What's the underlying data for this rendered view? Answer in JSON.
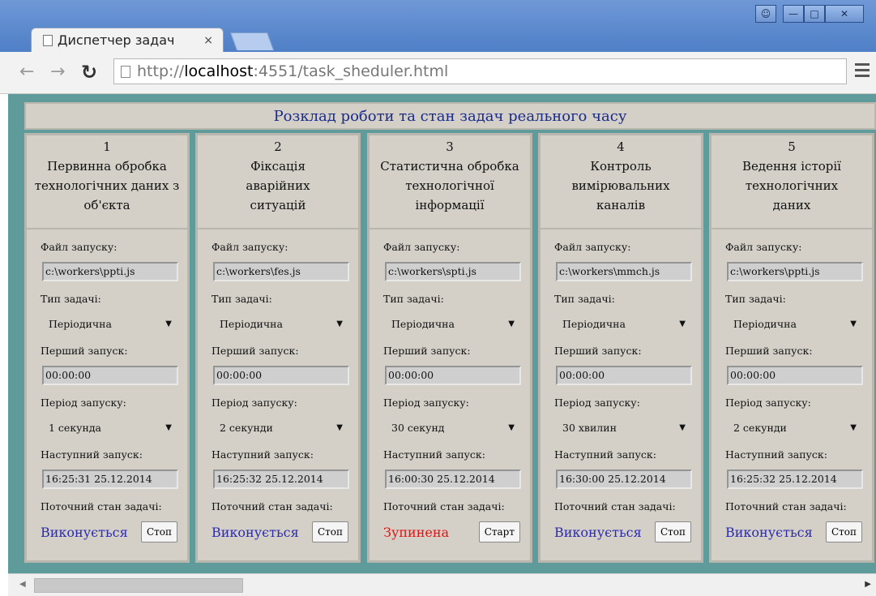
{
  "browser": {
    "tab_title": "Диспетчер задач",
    "tab_close": "×",
    "url_prefix": "http://",
    "url_host": "localhost",
    "url_rest": ":4551/task_sheduler.html"
  },
  "page": {
    "title": "Розклад роботи та стан задач реального часу",
    "labels": {
      "file": "Файл запуску:",
      "type": "Тип задачі:",
      "first": "Перший запуск:",
      "period": "Період запуску:",
      "next": "Наступний запуск:",
      "state": "Поточний стан задачі:"
    },
    "tasks": [
      {
        "num": "1",
        "name_lines": [
          "Первинна обробка",
          "технологічних даних з",
          "об'єкта"
        ],
        "file": "c:\\workers\\ppti.js",
        "type": "Періодична",
        "first": "00:00:00",
        "period": "1 секунда",
        "next": "16:25:31 25.12.2014",
        "status": "Виконується",
        "button": "Стоп",
        "running": true
      },
      {
        "num": "2",
        "name_lines": [
          "Фіксація",
          "аварійних",
          "ситуацій"
        ],
        "file": "c:\\workers\\fes.js",
        "type": "Періодична",
        "first": "00:00:00",
        "period": "2 секунди",
        "next": "16:25:32 25.12.2014",
        "status": "Виконується",
        "button": "Стоп",
        "running": true
      },
      {
        "num": "3",
        "name_lines": [
          "Статистична обробка",
          "технологічної",
          "інформації"
        ],
        "file": "c:\\workers\\spti.js",
        "type": "Періодична",
        "first": "00:00:00",
        "period": "30 секунд",
        "next": "16:00:30 25.12.2014",
        "status": "Зупинена",
        "button": "Старт",
        "running": false
      },
      {
        "num": "4",
        "name_lines": [
          "Контроль",
          "вимірювальних",
          "каналів"
        ],
        "file": "c:\\workers\\mmch.js",
        "type": "Періодична",
        "first": "00:00:00",
        "period": "30 хвилин",
        "next": "16:30:00 25.12.2014",
        "status": "Виконується",
        "button": "Стоп",
        "running": true
      },
      {
        "num": "5",
        "name_lines": [
          "Ведення історії",
          "технологічних",
          "даних"
        ],
        "file": "c:\\workers\\ppti.js",
        "type": "Періодична",
        "first": "00:00:00",
        "period": "2 секунди",
        "next": "16:25:32 25.12.2014",
        "status": "Виконується",
        "button": "Стоп",
        "running": true
      }
    ]
  },
  "colors": {
    "running": "#2b2bb0",
    "stopped": "#e01515",
    "background": "#5f9b9b"
  }
}
